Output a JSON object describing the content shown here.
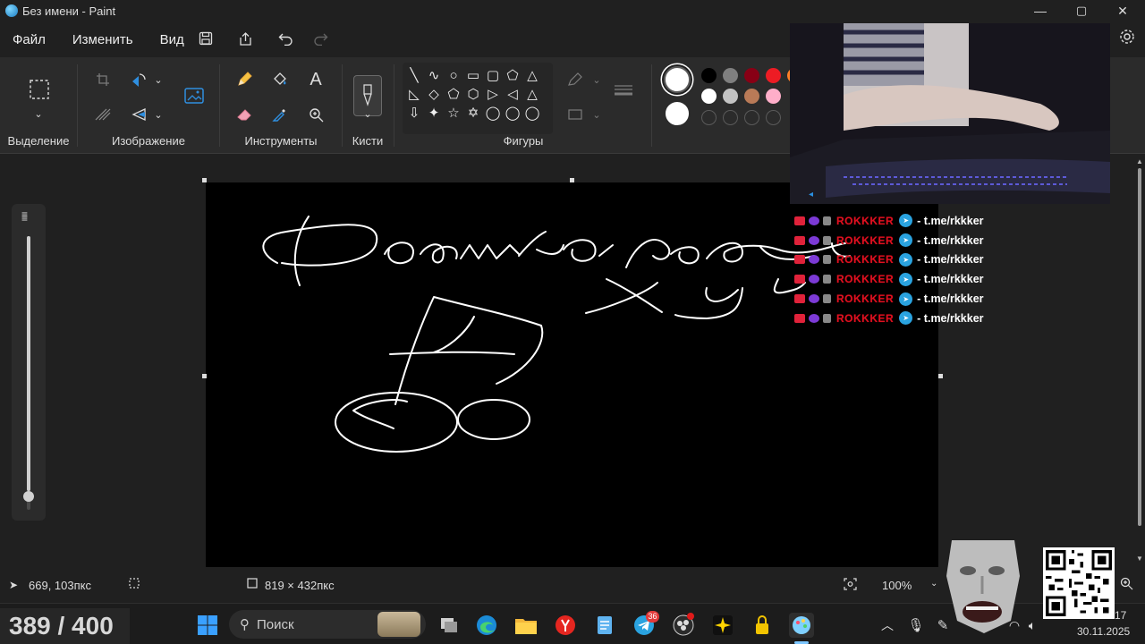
{
  "window": {
    "title": "Без имени - Paint",
    "controls": [
      "—",
      "▢",
      "✕"
    ]
  },
  "menu": {
    "file": "Файл",
    "edit": "Изменить",
    "view": "Вид"
  },
  "ribbon": {
    "groups": {
      "selection": "Выделение",
      "image": "Изображение",
      "tools": "Инструменты",
      "brushes": "Кисти",
      "shapes": "Фигуры"
    },
    "shapes": [
      "╲",
      "∿",
      "○",
      "▭",
      "▢",
      "⬠",
      "△",
      "◺",
      "◇",
      "⬠",
      "⬡",
      "▷",
      "◁",
      "△",
      "⇩",
      "✦",
      "☆",
      "✡",
      "◯",
      "◯",
      "◯"
    ],
    "palette_row1": [
      "#000000",
      "#7f7f7f",
      "#880015",
      "#ed1c24",
      "#ff7f27"
    ],
    "palette_row2": [
      "#ffffff",
      "#c3c3c3",
      "#b97a57",
      "#ffaec9"
    ],
    "current_color_1": "#ffffff",
    "current_color_2": "#ffffff"
  },
  "overlay": {
    "chat_rows": [
      {
        "name": "ROKKKER",
        "link": "- t.me/rkkker"
      },
      {
        "name": "ROKKKER",
        "link": "- t.me/rkkker"
      },
      {
        "name": "ROKKKER",
        "link": "- t.me/rkkker"
      },
      {
        "name": "ROKKKER",
        "link": "- t.me/rkkker"
      },
      {
        "name": "ROKKKER",
        "link": "- t.me/rkkker"
      },
      {
        "name": "ROKKKER",
        "link": "- t.me/rkkker"
      }
    ],
    "counter": "389 / 400"
  },
  "status": {
    "cursor_pos": "669, 103пкс",
    "canvas_size": "819 × 432пкс",
    "zoom": "100%"
  },
  "taskbar": {
    "search_placeholder": "Поиск",
    "telegram_badge": "36",
    "clock_time": "17",
    "clock_date": "30.11.2025"
  }
}
